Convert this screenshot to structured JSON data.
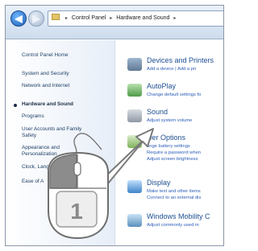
{
  "address_bar": {
    "crumbs": [
      "Control Panel",
      "Hardware and Sound"
    ]
  },
  "left_pane": {
    "home": "Control Panel Home",
    "items": [
      "System and Security",
      "Network and Internet",
      "Hardware and Sound",
      "Programs",
      "User Accounts and Family",
      "Safety",
      "Appearance and",
      "Personalization",
      "Clock, Lang",
      "Ease of A"
    ]
  },
  "right_pane": {
    "devices": {
      "title": "Devices and Printers",
      "links": [
        "Add a device",
        "Add a pri"
      ]
    },
    "autoplay": {
      "title": "AutoPlay",
      "links": [
        "Change default settings fo"
      ]
    },
    "sound": {
      "title": "Sound",
      "links": [
        "Adjust system volume"
      ]
    },
    "power": {
      "title": "wer Options",
      "links": [
        "ange battery settings",
        "Require a password when",
        "Adjust screen brightness"
      ]
    },
    "display": {
      "title": "Display",
      "links": [
        "Make text and other items",
        "Connect to an external dis"
      ]
    },
    "mobility": {
      "title": "Windows Mobility C",
      "links": [
        "Adjust commonly used m"
      ]
    }
  },
  "callout": {
    "step_number": "1"
  },
  "colors": {
    "link": "#2b5db8",
    "title": "#1d4f91",
    "pane_bg": "#e7eef8",
    "mouse_button": "#8c8c8c"
  }
}
